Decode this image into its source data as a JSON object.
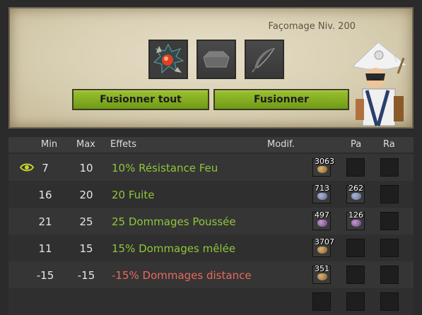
{
  "header": {
    "level_label": "Façomage Niv. 200",
    "buttons": {
      "merge_all": "Fusionner tout",
      "merge": "Fusionner"
    }
  },
  "table": {
    "columns": {
      "min": "Min",
      "max": "Max",
      "effects": "Effets",
      "modif": "Modif.",
      "pa": "Pa",
      "ra": "Ra"
    },
    "rows": [
      {
        "min": "7",
        "max": "10",
        "effect": "10% Résistance Feu",
        "kind": "positive",
        "modif": "3063",
        "pa": "",
        "ra": ""
      },
      {
        "min": "16",
        "max": "20",
        "effect": "20 Fuite",
        "kind": "positive",
        "modif": "713",
        "pa": "262",
        "ra": ""
      },
      {
        "min": "21",
        "max": "25",
        "effect": "25 Dommages Poussée",
        "kind": "positive",
        "modif": "497",
        "pa": "126",
        "ra": ""
      },
      {
        "min": "11",
        "max": "15",
        "effect": "15% Dommages mêlée",
        "kind": "positive",
        "modif": "3707",
        "pa": "",
        "ra": ""
      },
      {
        "min": "-15",
        "max": "-15",
        "effect": "-15% Dommages distance",
        "kind": "negative",
        "modif": "351",
        "pa": "",
        "ra": ""
      },
      {
        "min": "",
        "max": "",
        "effect": "",
        "kind": "empty",
        "modif": "",
        "pa": "",
        "ra": ""
      }
    ]
  },
  "colors": {
    "positive": "#8fc63a",
    "negative": "#e86a5a",
    "button": "#8db526"
  }
}
